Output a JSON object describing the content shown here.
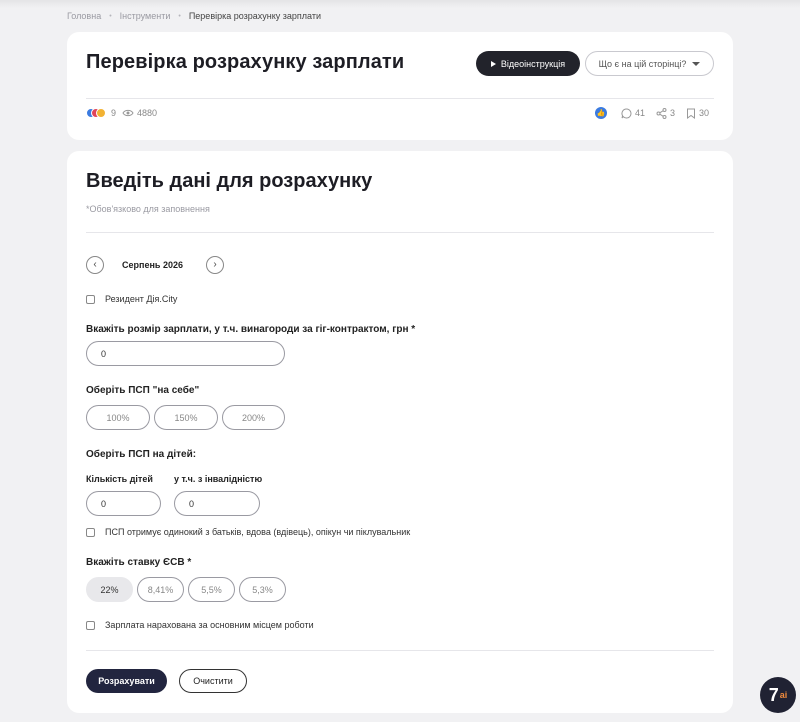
{
  "breadcrumb": [
    "Головна",
    "Інструменти",
    "Перевірка розрахунку зарплати"
  ],
  "header": {
    "title": "Перевірка розрахунку зарплати",
    "video_button": "Відеоінструкція",
    "what_dropdown": "Що є на цій сторінці?",
    "reactions_count": "9",
    "views": "4880",
    "comments": "41",
    "shares": "3",
    "bookmarks": "30"
  },
  "form": {
    "heading": "Введіть дані для розрахунку",
    "required_note": "*Обов'язково для заповнення",
    "month": "Серпень 2026",
    "resident_label": "Резидент Дія.City",
    "salary_label": "Вкажіть розмір зарплати, у т.ч. винагороди за гіг-контрактом, грн *",
    "salary_value": "0",
    "psp_self_label": "Оберіть ПСП \"на себе\"",
    "psp_self_options": [
      "100%",
      "150%",
      "200%"
    ],
    "psp_children_label": "Оберіть ПСП на дітей:",
    "children_count_label": "Кількість дітей",
    "children_count_value": "0",
    "disabled_children_label": "у т.ч. з інвалідністю",
    "disabled_children_value": "0",
    "single_parent_label": "ПСП отримує одинокий з батьків, вдова (вдівець), опікун чи піклувальник",
    "esv_label": "Вкажіть ставку ЄСВ *",
    "esv_options": [
      "22%",
      "8,41%",
      "5,5%",
      "5,3%"
    ],
    "main_job_label": "Зарплата нарахована за основним місцем роботи",
    "calculate_button": "Розрахувати",
    "clear_button": "Очистити"
  },
  "colors": {
    "primary_dark": "#22253f",
    "video_button": "#22232b",
    "like_blue": "#3b7be0",
    "logo_accent": "#f08a3c"
  },
  "logo": {
    "main": "7",
    "accent": "ai"
  }
}
